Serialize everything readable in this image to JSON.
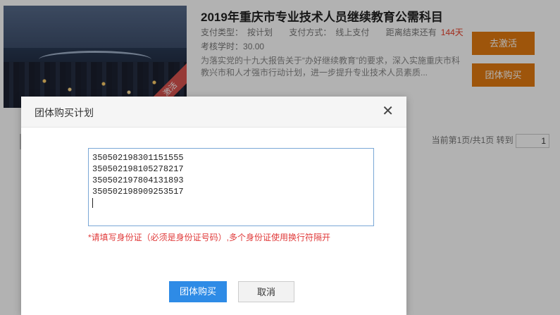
{
  "course": {
    "title": "2019年重庆市专业技术人员继续教育公需科目",
    "pay_type_label": "支付类型：",
    "pay_type_value": "按计划",
    "pay_method_label": "支付方式：",
    "pay_method_value": "线上支付",
    "deadline_label": "距离结束还有",
    "deadline_value": "144天",
    "hours_label": "考核学时：",
    "hours_value": "30.00",
    "description": "为落实党的十九大报告关于“办好继续教育”的要求，深入实施重庆市科教兴市和人才强市行动计划，进一步提升专业技术人员素质...",
    "ribbon": "激活",
    "activate_button": "去激活",
    "group_buy_button": "团体购买"
  },
  "pager": {
    "text": "当前第1页/共1页 转到",
    "page_input": "1"
  },
  "modal": {
    "title": "团体购买计划",
    "close_icon": "close-icon",
    "id_lines": [
      "350502198301151555",
      "350502198105278217",
      "350502197804131893",
      "350502198909253517"
    ],
    "hint": "*请填写身份证（必须是身份证号码）,多个身份证使用换行符隔开",
    "submit_button": "团体购买",
    "cancel_button": "取消"
  },
  "colors": {
    "accent_orange": "#e37a10",
    "primary_blue": "#2e8be6",
    "warning_red": "#e03a3a"
  }
}
